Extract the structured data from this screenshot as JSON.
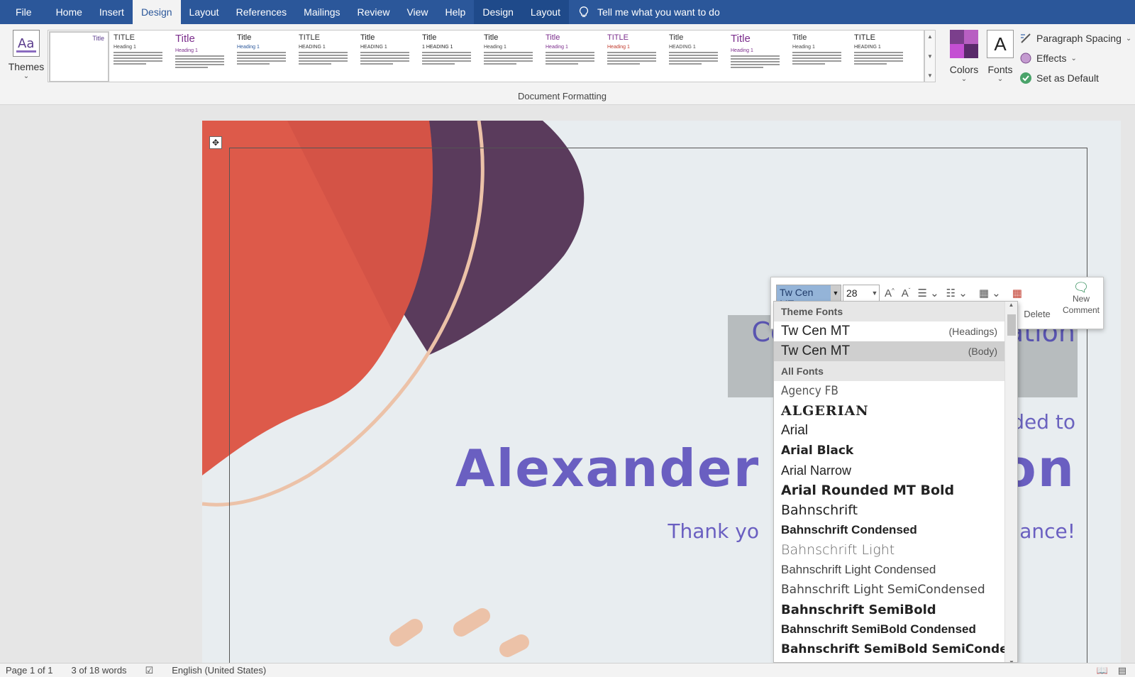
{
  "menubar": {
    "tabs": [
      "File",
      "Home",
      "Insert",
      "Design",
      "Layout",
      "References",
      "Mailings",
      "Review",
      "View",
      "Help",
      "Design",
      "Layout"
    ],
    "active_index": 3,
    "tell_me": "Tell me what you want to do"
  },
  "ribbon": {
    "themes_label": "Themes",
    "gallery": [
      {
        "title": "Title",
        "heading": ""
      },
      {
        "title": "TITLE",
        "heading": "Heading 1"
      },
      {
        "title": "Title",
        "heading": "Heading 1"
      },
      {
        "title": "Title",
        "heading": "Heading 1"
      },
      {
        "title": "TITLE",
        "heading": "HEADING 1"
      },
      {
        "title": "Title",
        "heading": "HEADING 1"
      },
      {
        "title": "Title",
        "heading": "1 HEADING 1"
      },
      {
        "title": "Title",
        "heading": "Heading 1"
      },
      {
        "title": "Title",
        "heading": "Heading 1"
      },
      {
        "title": "TITLE",
        "heading": "Heading 1"
      },
      {
        "title": "Title",
        "heading": "HEADING 1"
      },
      {
        "title": "Title",
        "heading": "Heading 1"
      },
      {
        "title": "Title",
        "heading": "Heading 1"
      },
      {
        "title": "TITLE",
        "heading": "HEADING 1"
      }
    ],
    "group_label": "Document Formatting",
    "colors_label": "Colors",
    "fonts_label": "Fonts",
    "paragraph_spacing": "Paragraph Spacing",
    "effects": "Effects",
    "set_default": "Set as Default"
  },
  "document": {
    "certificate_title_left": "Ce",
    "certificate_title_right": "iation",
    "awarded_partial": "ded to",
    "recipient_left": "Alexander",
    "recipient_right": "on",
    "thanks_left": "Thank yo",
    "thanks_right": "mance!"
  },
  "minibar": {
    "font": "Tw Cen MT",
    "size": "28",
    "delete_label": "Delete",
    "comment_label": "New Comment"
  },
  "font_dropdown": {
    "theme_header": "Theme Fonts",
    "theme_fonts": [
      {
        "name": "Tw Cen MT",
        "tag": "(Headings)"
      },
      {
        "name": "Tw Cen MT",
        "tag": "(Body)"
      }
    ],
    "all_header": "All Fonts",
    "all_fonts": [
      "Agency FB",
      "ALGERIAN",
      "Arial",
      "Arial Black",
      "Arial Narrow",
      "Arial Rounded MT Bold",
      "Bahnschrift",
      "Bahnschrift Condensed",
      "Bahnschrift Light",
      "Bahnschrift Light Condensed",
      "Bahnschrift Light SemiCondensed",
      "Bahnschrift SemiBold",
      "Bahnschrift SemiBold Condensed",
      "Bahnschrift SemiBold SemiConden"
    ]
  },
  "statusbar": {
    "page": "Page 1 of 1",
    "words": "3 of 18 words",
    "language": "English (United States)"
  },
  "colors": {
    "ribbon_blue": "#2b579a",
    "coral": "#dd5a4a",
    "plum": "#5a3b5c",
    "peach": "#ecc2a8",
    "purple_text": "#6a5fc1"
  }
}
